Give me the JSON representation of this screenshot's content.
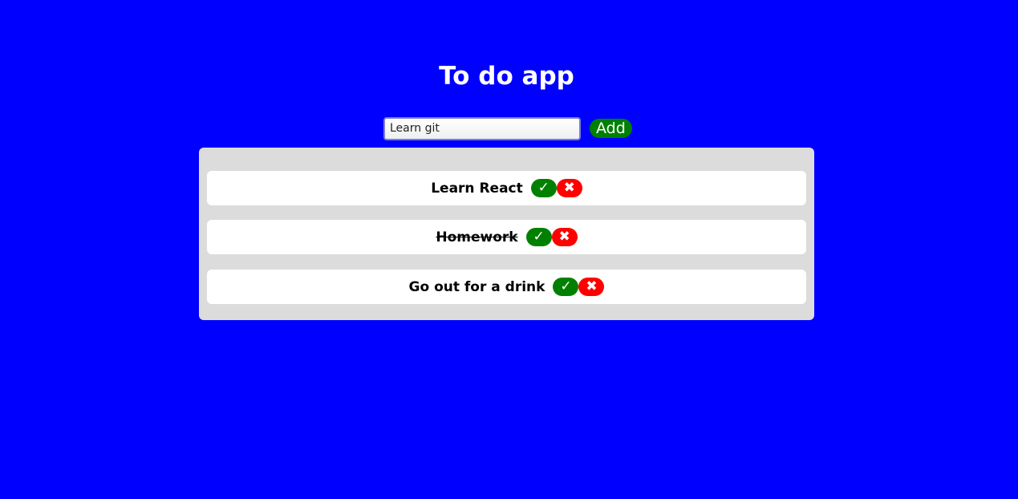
{
  "app": {
    "title": "To do app"
  },
  "form": {
    "input_value": "Learn git",
    "add_label": "Add"
  },
  "todos": [
    {
      "text": "Learn React",
      "done": false,
      "check_icon": "✓",
      "delete_icon": "✖"
    },
    {
      "text": "Homework",
      "done": true,
      "check_icon": "✓",
      "delete_icon": "✖"
    },
    {
      "text": "Go out for a drink",
      "done": false,
      "check_icon": "✓",
      "delete_icon": "✖"
    }
  ],
  "colors": {
    "background": "#0000ff",
    "panel": "#dcdcdc",
    "done_button": "#008000",
    "delete_button": "#ff0000",
    "add_button": "#008000"
  }
}
